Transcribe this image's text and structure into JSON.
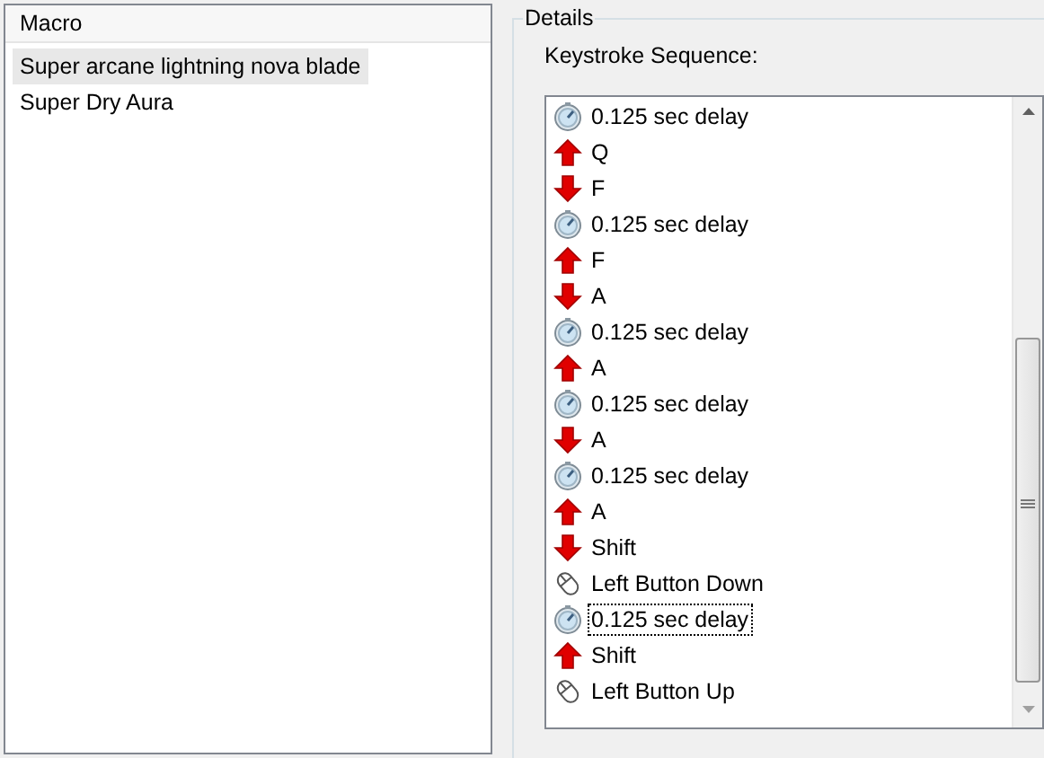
{
  "macro_list": {
    "header": "Macro",
    "items": [
      {
        "label": "Super arcane lightning nova blade",
        "selected": true
      },
      {
        "label": "Super Dry Aura",
        "selected": false
      }
    ]
  },
  "details": {
    "title": "Details",
    "sequence_label": "Keystroke Sequence:",
    "steps": [
      {
        "kind": "delay",
        "label": "0.125 sec delay",
        "focused": false
      },
      {
        "kind": "key_up",
        "label": "Q",
        "focused": false
      },
      {
        "kind": "key_down",
        "label": "F",
        "focused": false
      },
      {
        "kind": "delay",
        "label": "0.125 sec delay",
        "focused": false
      },
      {
        "kind": "key_up",
        "label": "F",
        "focused": false
      },
      {
        "kind": "key_down",
        "label": "A",
        "focused": false
      },
      {
        "kind": "delay",
        "label": "0.125 sec delay",
        "focused": false
      },
      {
        "kind": "key_up",
        "label": "A",
        "focused": false
      },
      {
        "kind": "delay",
        "label": "0.125 sec delay",
        "focused": false
      },
      {
        "kind": "key_down",
        "label": "A",
        "focused": false
      },
      {
        "kind": "delay",
        "label": "0.125 sec delay",
        "focused": false
      },
      {
        "kind": "key_up",
        "label": "A",
        "focused": false
      },
      {
        "kind": "key_down",
        "label": "Shift",
        "focused": false
      },
      {
        "kind": "mouse",
        "label": "Left Button Down",
        "focused": false
      },
      {
        "kind": "delay",
        "label": "0.125 sec delay",
        "focused": true
      },
      {
        "kind": "key_up",
        "label": "Shift",
        "focused": false
      },
      {
        "kind": "mouse",
        "label": "Left Button Up",
        "focused": false
      }
    ]
  }
}
